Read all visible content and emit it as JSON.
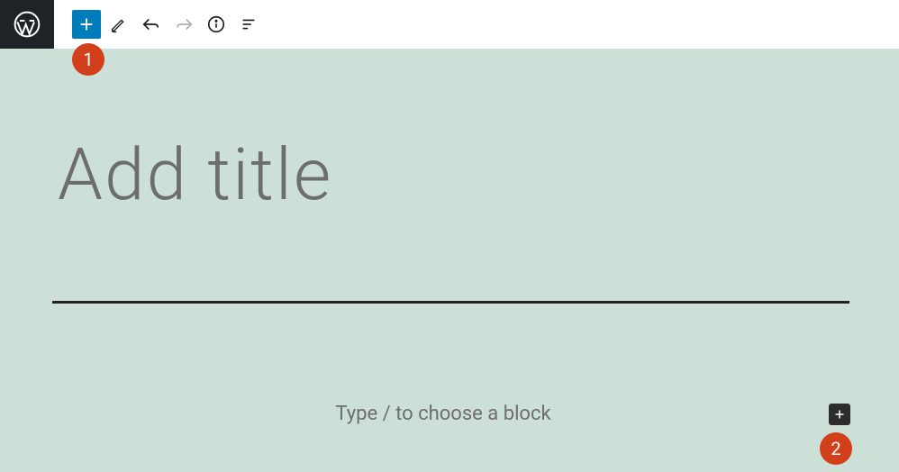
{
  "toolbar": {
    "icons": {
      "add": "plus-icon",
      "edit": "edit-icon",
      "undo": "undo-icon",
      "redo": "redo-icon",
      "info": "info-icon",
      "outline": "outline-icon"
    }
  },
  "editor": {
    "title_placeholder": "Add title",
    "body_placeholder": "Type / to choose a block"
  },
  "callouts": {
    "one": "1",
    "two": "2"
  },
  "colors": {
    "accent": "#007cba",
    "canvas": "#cde0d7",
    "callout": "#d1401b"
  }
}
